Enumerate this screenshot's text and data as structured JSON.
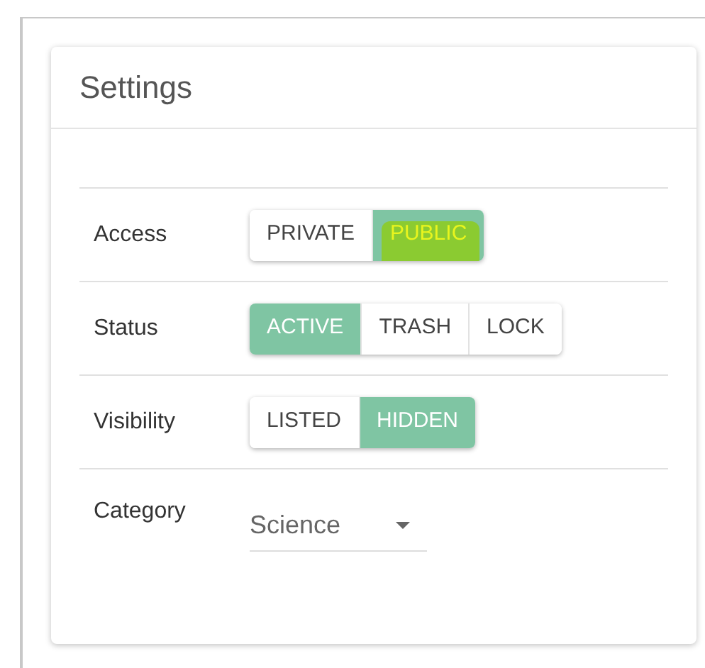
{
  "card": {
    "title": "Settings"
  },
  "rows": [
    {
      "label": "Access",
      "kind": "toggle",
      "options": [
        {
          "label": "PRIVATE",
          "selected": false,
          "highlighted": false
        },
        {
          "label": "PUBLIC",
          "selected": true,
          "highlighted": true
        }
      ]
    },
    {
      "label": "Status",
      "kind": "toggle",
      "options": [
        {
          "label": "ACTIVE",
          "selected": true,
          "highlighted": false
        },
        {
          "label": "TRASH",
          "selected": false,
          "highlighted": false
        },
        {
          "label": "LOCK",
          "selected": false,
          "highlighted": false
        }
      ]
    },
    {
      "label": "Visibility",
      "kind": "toggle",
      "options": [
        {
          "label": "LISTED",
          "selected": false,
          "highlighted": false
        },
        {
          "label": "HIDDEN",
          "selected": true,
          "highlighted": false
        }
      ]
    },
    {
      "label": "Category",
      "kind": "select",
      "value": "Science"
    }
  ]
}
